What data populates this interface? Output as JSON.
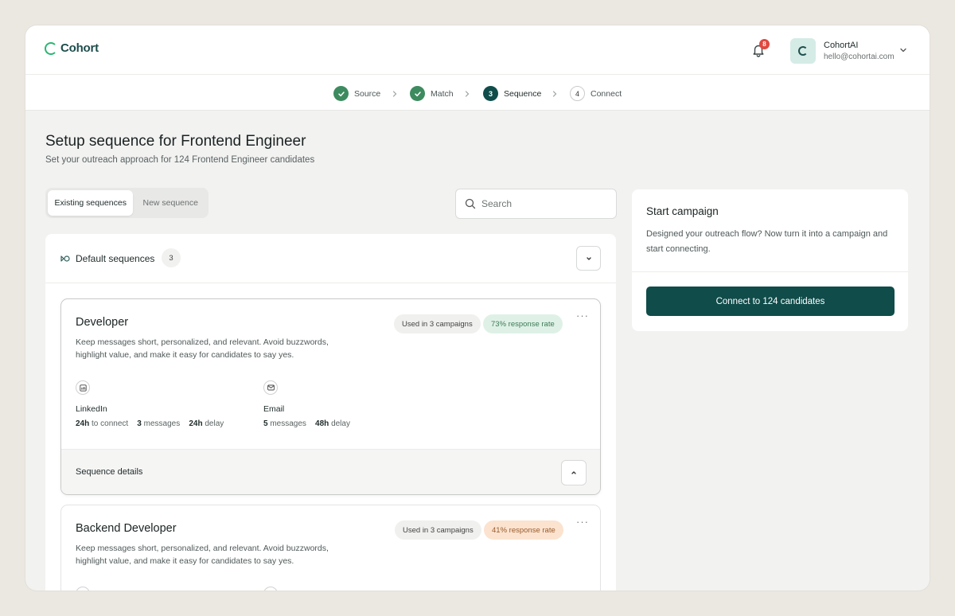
{
  "app": {
    "brand": "Cohort",
    "notification_count": "8"
  },
  "account": {
    "name": "CohortAI",
    "email": "hello@cohortai.com"
  },
  "stepper": {
    "steps": [
      {
        "label": "Source",
        "state": "done"
      },
      {
        "label": "Match",
        "state": "done"
      },
      {
        "number": "3",
        "label": "Sequence",
        "state": "active"
      },
      {
        "number": "4",
        "label": "Connect",
        "state": "todo"
      }
    ]
  },
  "page": {
    "title": "Setup sequence for Frontend Engineer",
    "subtitle": "Set your outreach approach for 124 Frontend Engineer candidates"
  },
  "tabs": {
    "existing": "Existing sequences",
    "new": "New sequence"
  },
  "search": {
    "placeholder": "Search",
    "value": ""
  },
  "sequences": {
    "group_title": "Default sequences",
    "count": "3",
    "items": [
      {
        "title": "Developer",
        "description": "Keep messages short, personalized, and relevant. Avoid buzzwords, highlight value, and make it easy for candidates to say yes.",
        "used_in": "Used in 3 campaigns",
        "response_rate": "73% response rate",
        "details_label": "Sequence details",
        "channels": [
          {
            "name": "LinkedIn",
            "icon": "linkedin-icon",
            "stats": [
              {
                "value": "24h",
                "unit": "to connect"
              },
              {
                "value": "3",
                "unit": "messages"
              },
              {
                "value": "24h",
                "unit": "delay"
              }
            ]
          },
          {
            "name": "Email",
            "icon": "mail-icon",
            "stats": [
              {
                "value": "5",
                "unit": "messages"
              },
              {
                "value": "48h",
                "unit": "delay"
              }
            ]
          }
        ]
      },
      {
        "title": "Backend Developer",
        "description": "Keep messages short, personalized, and relevant. Avoid buzzwords, highlight value, and make it easy for candidates to say yes.",
        "used_in": "Used in 3 campaigns",
        "response_rate": "41% response rate"
      }
    ]
  },
  "campaign": {
    "title": "Start campaign",
    "description": "Designed your outreach flow? Now turn it into a campaign and start connecting.",
    "button": "Connect to 124 candidates"
  },
  "colors": {
    "primary": "#0f4c4a",
    "brand_green": "#2bb673",
    "step_done": "#3d8b5f",
    "badge_red": "#e0493f",
    "rate_good_bg": "#dff1e6",
    "rate_warn_bg": "#fbe3cf"
  }
}
